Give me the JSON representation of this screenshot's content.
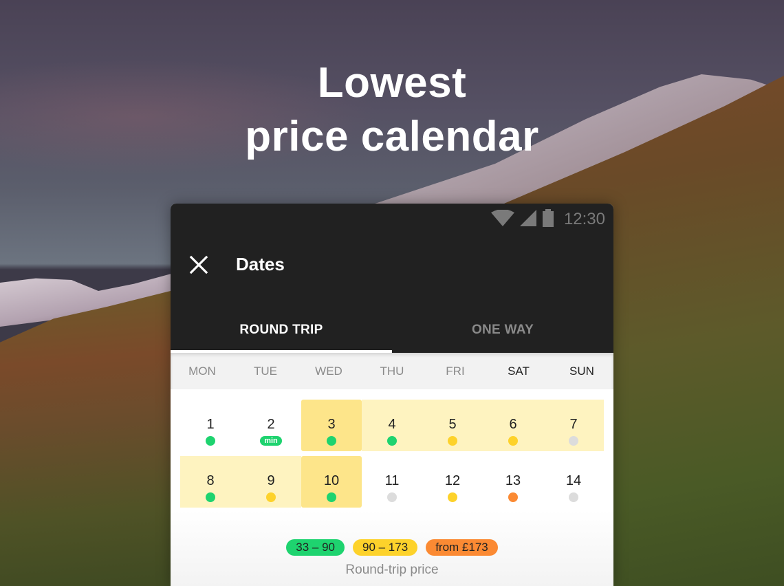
{
  "headline": {
    "line1": "Lowest",
    "line2": "price calendar"
  },
  "statusbar": {
    "time": "12:30",
    "icons": [
      "wifi-icon",
      "cell-signal-icon",
      "battery-icon"
    ]
  },
  "appbar": {
    "close_icon": "close-icon",
    "title": "Dates"
  },
  "tabs": [
    {
      "label": "ROUND TRIP",
      "active": true
    },
    {
      "label": "ONE WAY",
      "active": false
    }
  ],
  "weekdays": [
    "MON",
    "TUE",
    "WED",
    "THU",
    "FRI",
    "SAT",
    "SUN"
  ],
  "price_colors": {
    "low": "#1ed36f",
    "mid": "#fdd22b",
    "high": "#fb8a33",
    "none": "#dcdcdc"
  },
  "calendar": {
    "weeks": [
      [
        {
          "day": "1",
          "price": "low"
        },
        {
          "day": "2",
          "price": "low",
          "badge": "min"
        },
        {
          "day": "3",
          "price": "low",
          "selection": "start"
        },
        {
          "day": "4",
          "price": "low",
          "selection": "range"
        },
        {
          "day": "5",
          "price": "mid",
          "selection": "range"
        },
        {
          "day": "6",
          "price": "mid",
          "selection": "range"
        },
        {
          "day": "7",
          "price": "none",
          "selection": "range"
        }
      ],
      [
        {
          "day": "8",
          "price": "low",
          "selection": "range"
        },
        {
          "day": "9",
          "price": "mid",
          "selection": "range"
        },
        {
          "day": "10",
          "price": "low",
          "selection": "end"
        },
        {
          "day": "11",
          "price": "none"
        },
        {
          "day": "12",
          "price": "mid"
        },
        {
          "day": "13",
          "price": "high"
        },
        {
          "day": "14",
          "price": "none"
        }
      ]
    ]
  },
  "legend": {
    "chips": [
      {
        "label": "33 – 90",
        "level": "low"
      },
      {
        "label": "90 – 173",
        "level": "mid"
      },
      {
        "label": "from £173",
        "level": "high"
      }
    ],
    "caption": "Round-trip price"
  }
}
